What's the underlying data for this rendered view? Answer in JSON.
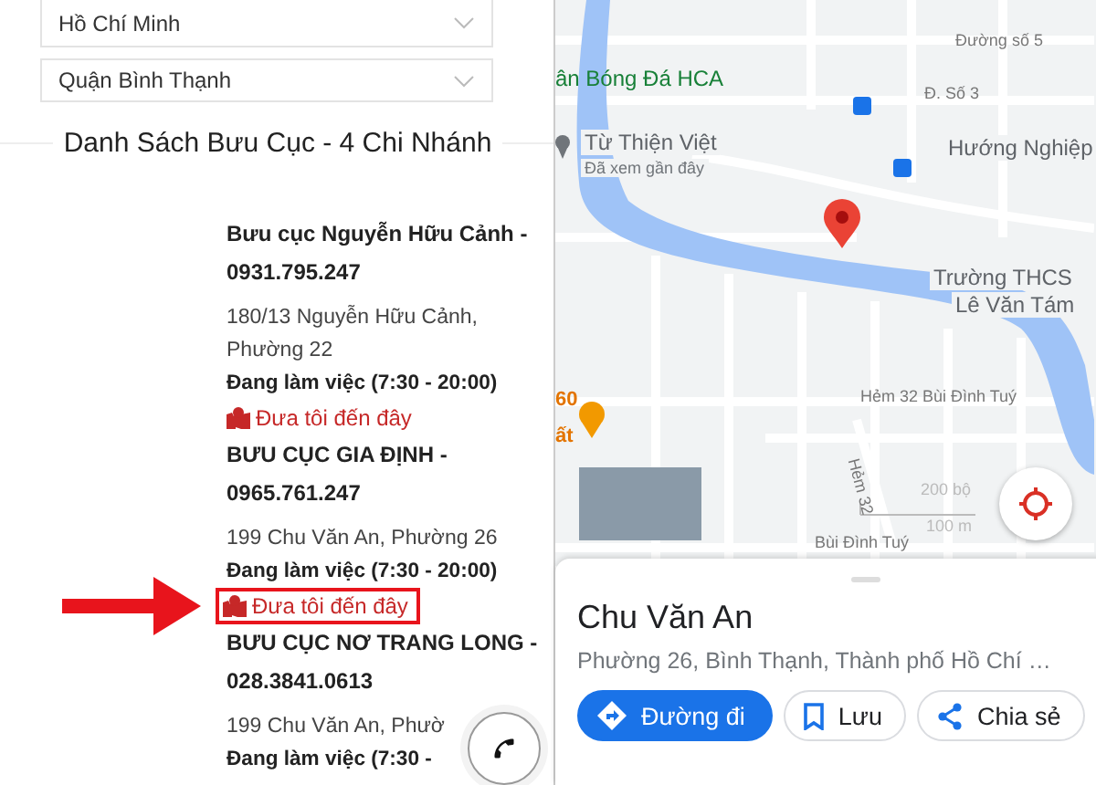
{
  "filters": [
    {
      "value": "Hồ Chí Minh"
    },
    {
      "value": "Quận Bình Thạnh"
    }
  ],
  "list_title": "Danh Sách Bưu Cục - 4 Chi Nhánh",
  "offices": [
    {
      "name": "Bưu cục Nguyễn Hữu Cảnh - 0931.795.247",
      "address": "180/13 Nguyễn Hữu Cảnh, Phường 22",
      "hours": "Đang làm việc (7:30 - 20:00)",
      "link": "Đưa tôi đến đây",
      "highlighted": false
    },
    {
      "name": "BƯU CỤC GIA ĐỊNH - 0965.761.247",
      "address": "199 Chu Văn An, Phường 26",
      "hours": "Đang làm việc (7:30 - 20:00)",
      "link": "Đưa tôi đến đây",
      "highlighted": true
    },
    {
      "name": "BƯU CỤC NƠ TRANG LONG - 028.3841.0613",
      "address": "199 Chu Văn An, Phườ",
      "hours": "Đang làm việc (7:30 -"
    }
  ],
  "map": {
    "labels": [
      {
        "text": "ân Bóng Đá HCA",
        "kind": "park"
      },
      {
        "text": "Đường số 5",
        "kind": "street"
      },
      {
        "text": "Đ. Số 3",
        "kind": "street"
      },
      {
        "text": "Từ Thiện Việt",
        "kind": "place"
      },
      {
        "text": "Hướng Nghiệp",
        "kind": "place"
      },
      {
        "text": "Đã xem gần đây",
        "kind": "note"
      },
      {
        "text": "Trường THCS",
        "kind": "place"
      },
      {
        "text": "Lê Văn Tám",
        "kind": "place"
      },
      {
        "text": "60",
        "kind": "food"
      },
      {
        "text": "ất",
        "kind": "food"
      },
      {
        "text": "Hẻm 32 Bùi Đình Tuý",
        "kind": "street"
      },
      {
        "text": "Hẻm 32",
        "kind": "street-vertical"
      },
      {
        "text": "Bùi Đình Tuý",
        "kind": "street"
      },
      {
        "text": "200 bộ",
        "kind": "scale"
      },
      {
        "text": "100 m",
        "kind": "scale"
      }
    ],
    "place": {
      "title": "Chu Văn An",
      "address": "Phường 26, Bình Thạnh, Thành phố Hồ Chí …",
      "buttons": [
        {
          "label": "Đường đi",
          "kind": "primary"
        },
        {
          "label": "Lưu",
          "kind": "save"
        },
        {
          "label": "Chia sẻ",
          "kind": "share"
        }
      ]
    }
  }
}
